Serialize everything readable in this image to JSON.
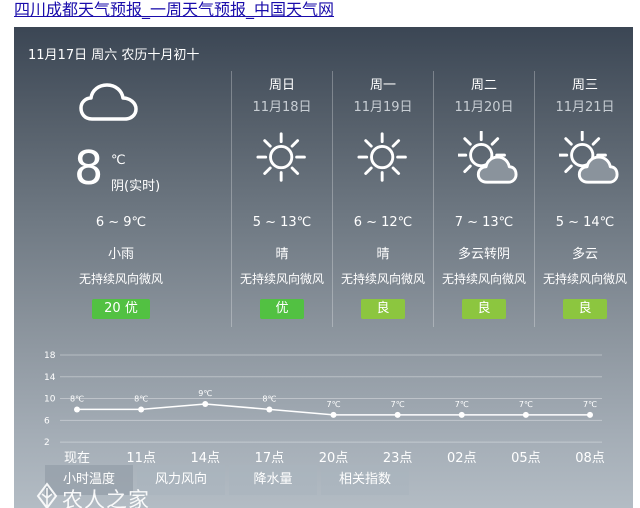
{
  "page_title": "四川成都天气预报_一周天气预报_中国天气网",
  "header": {
    "date_text": "11月17日 周六 农历十月初十"
  },
  "today": {
    "icon": "cloud-icon",
    "temp": "8",
    "unit": "℃",
    "realtime_label": "阴(实时)",
    "range": "6 ~ 9℃",
    "condition": "小雨",
    "wind": "无持续风向微风",
    "aqi": "20 优",
    "aqi_color": "#52c142"
  },
  "days": [
    {
      "name": "周日",
      "date": "11月18日",
      "icon": "sun-icon",
      "range": "5 ~ 13℃",
      "condition": "晴",
      "wind": "无持续风向微风",
      "aqi": "优",
      "aqi_color": "#52c142"
    },
    {
      "name": "周一",
      "date": "11月19日",
      "icon": "sun-icon",
      "range": "6 ~ 12℃",
      "condition": "晴",
      "wind": "无持续风向微风",
      "aqi": "良",
      "aqi_color": "#8cc63f"
    },
    {
      "name": "周二",
      "date": "11月20日",
      "icon": "sun-cloud-icon",
      "range": "7 ~ 13℃",
      "condition": "多云转阴",
      "wind": "无持续风向微风",
      "aqi": "良",
      "aqi_color": "#8cc63f"
    },
    {
      "name": "周三",
      "date": "11月21日",
      "icon": "sun-cloud-icon",
      "range": "5 ~ 14℃",
      "condition": "多云",
      "wind": "无持续风向微风",
      "aqi": "良",
      "aqi_color": "#8cc63f"
    }
  ],
  "chart_data": {
    "type": "line",
    "y_ticks": [
      "18",
      "14",
      "10",
      "6",
      "2"
    ],
    "ylim": [
      0,
      18
    ],
    "x": [
      "现在",
      "11点",
      "14点",
      "17点",
      "20点",
      "23点",
      "02点",
      "05点",
      "08点"
    ],
    "series": [
      {
        "values": [
          8,
          8,
          9,
          8,
          7,
          7,
          7,
          7,
          7
        ],
        "labels": [
          "8℃",
          "8℃",
          "9℃",
          "8℃",
          "7℃",
          "7℃",
          "7℃",
          "7℃",
          "7℃"
        ]
      }
    ],
    "grid": true
  },
  "tabs": [
    {
      "label": "小时温度",
      "active": true
    },
    {
      "label": "风力风向",
      "active": false
    },
    {
      "label": "降水量",
      "active": false
    },
    {
      "label": "相关指数",
      "active": false
    }
  ],
  "watermark": {
    "text": "农人之家"
  }
}
